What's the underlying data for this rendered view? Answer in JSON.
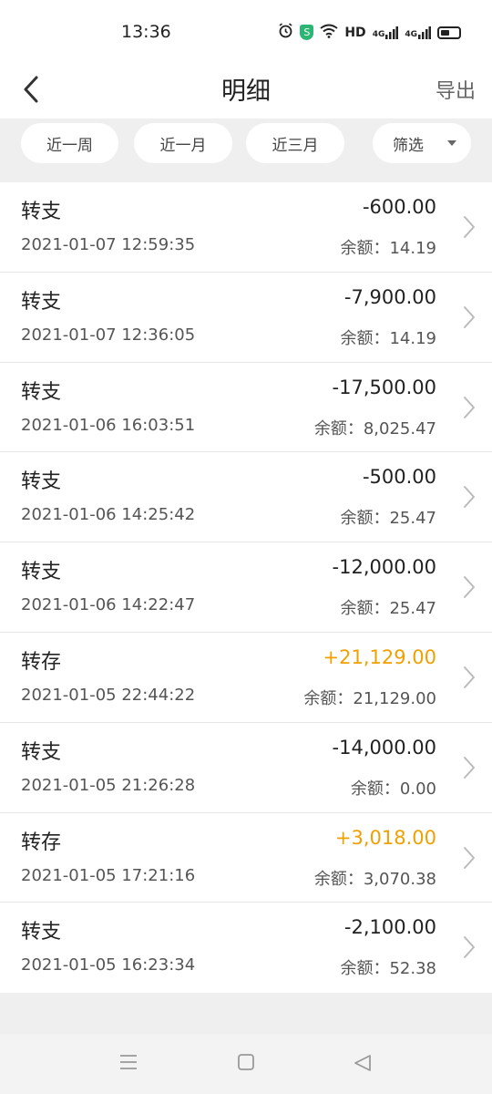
{
  "status_bar": {
    "time": "13:36",
    "hd_label": "HD",
    "net1": "4G",
    "net2": "4G",
    "shield_glyph": "S"
  },
  "header": {
    "title": "明细",
    "export_label": "导出"
  },
  "filters": {
    "week": "近一周",
    "month": "近一月",
    "three_months": "近三月",
    "filter": "筛选"
  },
  "colors": {
    "income": "#f0a000",
    "expense": "#222222"
  },
  "transactions": [
    {
      "type": "转支",
      "time": "2021-01-07 12:59:35",
      "amount": "-600.00",
      "balance": "余额：14.19",
      "direction": "out"
    },
    {
      "type": "转支",
      "time": "2021-01-07 12:36:05",
      "amount": "-7,900.00",
      "balance": "余额：14.19",
      "direction": "out"
    },
    {
      "type": "转支",
      "time": "2021-01-06 16:03:51",
      "amount": "-17,500.00",
      "balance": "余额：8,025.47",
      "direction": "out"
    },
    {
      "type": "转支",
      "time": "2021-01-06 14:25:42",
      "amount": "-500.00",
      "balance": "余额：25.47",
      "direction": "out"
    },
    {
      "type": "转支",
      "time": "2021-01-06 14:22:47",
      "amount": "-12,000.00",
      "balance": "余额：25.47",
      "direction": "out"
    },
    {
      "type": "转存",
      "time": "2021-01-05 22:44:22",
      "amount": "+21,129.00",
      "balance": "余额：21,129.00",
      "direction": "in"
    },
    {
      "type": "转支",
      "time": "2021-01-05 21:26:28",
      "amount": "-14,000.00",
      "balance": "余额：0.00",
      "direction": "out"
    },
    {
      "type": "转存",
      "time": "2021-01-05 17:21:16",
      "amount": "+3,018.00",
      "balance": "余额：3,070.38",
      "direction": "in"
    },
    {
      "type": "转支",
      "time": "2021-01-05 16:23:34",
      "amount": "-2,100.00",
      "balance": "余额：52.38",
      "direction": "out"
    }
  ]
}
